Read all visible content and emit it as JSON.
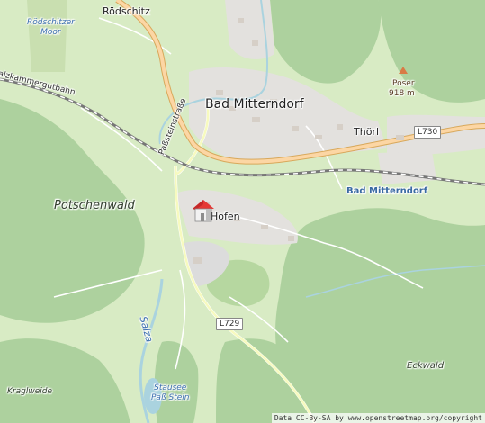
{
  "map": {
    "labels": {
      "rodschitz": "Rödschitz",
      "rodschitzer_moor": "Rödschitzer\nMoor",
      "bad_mitterndorf": "Bad Mitterndorf",
      "thorl": "Thörl",
      "poser": "Poser",
      "poser_elev": "918 m",
      "potschenwald": "Potschenwald",
      "paßsteinstraße": "Paßsteinstraße",
      "hofen": "Hofen",
      "station": "Bad Mitterndorf",
      "salza": "Salza",
      "stausee": "Stausee\nPaß Stein",
      "kraglweide": "Kraglweide",
      "eckwald": "Eckwald",
      "salzkammergutbahn": "Salzkammergutbahn"
    },
    "road_refs": {
      "l730": "L730",
      "l729": "L729"
    },
    "attribution": "Data CC-By-SA by www.openstreetmap.org/copyright",
    "marker_icon": "house-icon",
    "colors": {
      "meadow": "#d8ebc4",
      "forest": "#add19e",
      "urban": "#e0dfdf",
      "water": "#aad3df",
      "road_primary": "#fcd6a4",
      "road_secondary": "#f7fabf",
      "road_motorway": "#e892a2",
      "marker": "#e53935"
    }
  }
}
